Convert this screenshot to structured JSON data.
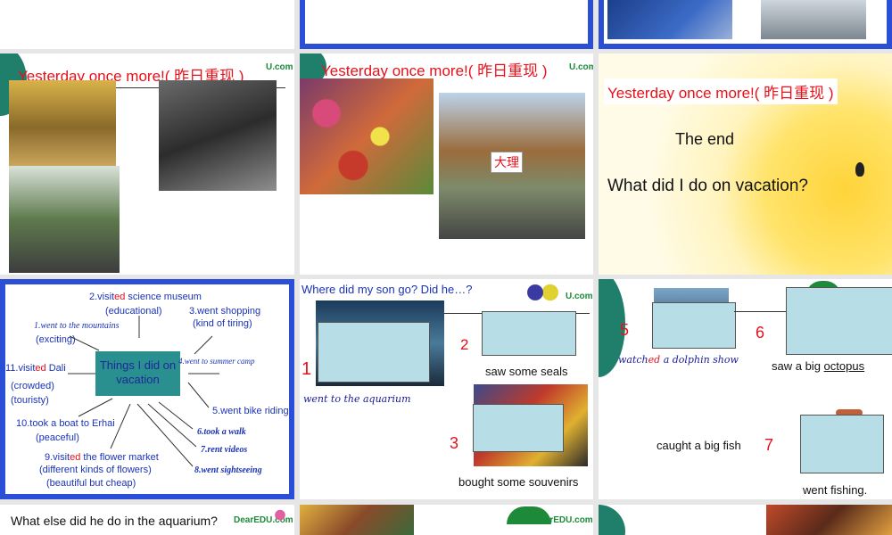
{
  "slides": {
    "s4": {
      "title": "Yesterday once more!( 昨日重现 )",
      "logo": "U.com"
    },
    "s5": {
      "title": "Yesterday once more!( 昨日重现 )",
      "logo": "U.com",
      "photo_label": "大理"
    },
    "s6": {
      "title": "Yesterday once more!( 昨日重现 )",
      "line1": "The end",
      "line2": "What did I do on vacation?"
    },
    "s7": {
      "center": "Things I did on vacation",
      "items": {
        "i2": "2.visited  science museum",
        "i2_note": "(educational)",
        "i3": "3.went shopping",
        "i3_note": "(kind of tiring)",
        "i1": "1.went to the mountains",
        "i1_note": "(exciting)",
        "i4": "4.went to summer camp",
        "i11": "11.visited Dali",
        "i11_note1": "(crowded)",
        "i11_note2": "(touristy)",
        "i5": "5.went bike riding",
        "i10": "10.took a boat to Erhai",
        "i10_note": "(peaceful)",
        "i6": "6.took a walk",
        "i7": "7.rent videos",
        "i9": "9.visited the flower market",
        "i9_note1": "(different kinds of flowers)",
        "i9_note2": "(beautiful but cheap)",
        "i8": "8.went sightseeing"
      }
    },
    "s8": {
      "title": "Where did my son go?  Did he…?",
      "logo": "U.com",
      "n1": "1",
      "c1": "went to the aquarium",
      "n2": "2",
      "c2": "saw some seals",
      "n3": "3",
      "c3": "bought some souvenirs"
    },
    "s9": {
      "n5": "5",
      "c5": "watched a dolphin show",
      "n6": "6",
      "c6": "saw a big octopus",
      "n7": "7",
      "c7": "caught a big fish",
      "c8": "went fishing."
    },
    "s10": {
      "title": "What else did he do in the aquarium?",
      "logo": "DearEDU.com"
    },
    "s11": {
      "logo": "DearEDU.com"
    }
  }
}
